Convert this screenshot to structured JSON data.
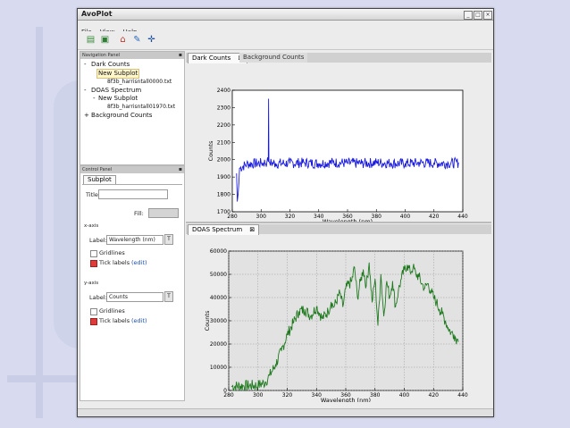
{
  "window": {
    "title": "AvoPlot"
  },
  "menu": [
    "File",
    "View",
    "Help"
  ],
  "toolbar_icons": [
    "new-plot-icon",
    "open-icon",
    "home-icon",
    "edit-icon",
    "move-icon"
  ],
  "nav_panel": {
    "title": "Navigation Panel",
    "tree": [
      {
        "label": "Dark Counts",
        "toggle": "-",
        "level": 0
      },
      {
        "label": "New Subplot",
        "toggle": "",
        "level": 1,
        "selected": true
      },
      {
        "label": "8f3b_harrisntall0000.txt",
        "toggle": "",
        "level": 2
      },
      {
        "label": "DOAS Spectrum",
        "toggle": "-",
        "level": 0
      },
      {
        "label": "New Subplot",
        "toggle": "-",
        "level": 1
      },
      {
        "label": "8f3b_harrisntall01970.txt",
        "toggle": "",
        "level": 2
      },
      {
        "label": "Background Counts",
        "toggle": "+",
        "level": 0
      }
    ]
  },
  "control_panel": {
    "title": "Control Panel",
    "tab": "Subplot",
    "title_label": "Title:",
    "title_value": "",
    "fill_label": "Fill:",
    "x_axis": {
      "heading": "x-axis",
      "label_label": "Label:",
      "label_value": "Wavelength (nm)",
      "gridlines": "Gridlines",
      "gridlines_checked": false,
      "ticks": "Tick labels",
      "ticks_checked": true,
      "edit": "(edit)"
    },
    "y_axis": {
      "heading": "y-axis",
      "label_label": "Label:",
      "label_value": "Counts",
      "gridlines": "Gridlines",
      "gridlines_checked": false,
      "ticks": "Tick labels",
      "ticks_checked": true,
      "edit": "(edit)"
    }
  },
  "top_tabs": [
    "Dark Counts",
    "Background Counts"
  ],
  "bottom_tabs": [
    "DOAS Spectrum"
  ],
  "colors": {
    "dark_line": "#1a1adf",
    "doas_line": "#1f7a1f",
    "doas_bg": "#e2e2e2"
  },
  "chart_data": [
    {
      "type": "line",
      "title": "",
      "xlabel": "Wavelength (nm)",
      "ylabel": "Counts",
      "xlim": [
        280,
        440
      ],
      "ylim": [
        1700,
        2400
      ],
      "xticks": [
        280,
        300,
        320,
        340,
        360,
        380,
        400,
        420,
        440
      ],
      "yticks": [
        1700,
        1800,
        1900,
        2000,
        2100,
        2200,
        2300,
        2400
      ],
      "grid": false,
      "series": [
        {
          "x": [
            283,
            283.5,
            284,
            284.5,
            285,
            290,
            300,
            304,
            305,
            305.2,
            305.4,
            306,
            310,
            320,
            330,
            340,
            350,
            360,
            370,
            380,
            390,
            400,
            410,
            420,
            430,
            437
          ],
          "y": [
            1920,
            1760,
            1800,
            1860,
            1950,
            1975,
            1980,
            1985,
            1990,
            2350,
            1990,
            1982,
            1978,
            1980,
            1982,
            1978,
            1984,
            1980,
            1979,
            1983,
            1980,
            1978,
            1982,
            1980,
            1979,
            1982
          ]
        }
      ]
    },
    {
      "type": "line",
      "title": "",
      "xlabel": "Wavelength (nm)",
      "ylabel": "Counts",
      "xlim": [
        280,
        440
      ],
      "ylim": [
        0,
        60000
      ],
      "xticks": [
        280,
        300,
        320,
        340,
        360,
        380,
        400,
        420,
        440
      ],
      "yticks": [
        0,
        10000,
        20000,
        30000,
        40000,
        50000,
        60000
      ],
      "grid": true,
      "series": [
        {
          "x": [
            282,
            290,
            300,
            305,
            308,
            312,
            316,
            320,
            324,
            328,
            332,
            336,
            340,
            344,
            348,
            350,
            352,
            356,
            358,
            360,
            364,
            366,
            368,
            370,
            372,
            374,
            376,
            378,
            380,
            382,
            384,
            386,
            388,
            390,
            392,
            394,
            396,
            398,
            400,
            402,
            404,
            406,
            408,
            410,
            412,
            414,
            416,
            418,
            420,
            422,
            424,
            426,
            428,
            430,
            432,
            434,
            436,
            437
          ],
          "y": [
            1800,
            2000,
            2200,
            3500,
            6500,
            11000,
            17000,
            24000,
            29000,
            34000,
            35000,
            32000,
            36000,
            31000,
            34000,
            38000,
            36000,
            42000,
            36000,
            44000,
            47000,
            53000,
            40000,
            47000,
            52000,
            45000,
            55000,
            38000,
            48000,
            28000,
            50000,
            32000,
            47000,
            40000,
            47000,
            36000,
            43000,
            48000,
            52000,
            54000,
            51000,
            53000,
            50000,
            49000,
            46000,
            44000,
            46000,
            43000,
            40000,
            38000,
            35000,
            33000,
            30000,
            27000,
            25000,
            24000,
            22000,
            21000
          ]
        }
      ]
    }
  ]
}
